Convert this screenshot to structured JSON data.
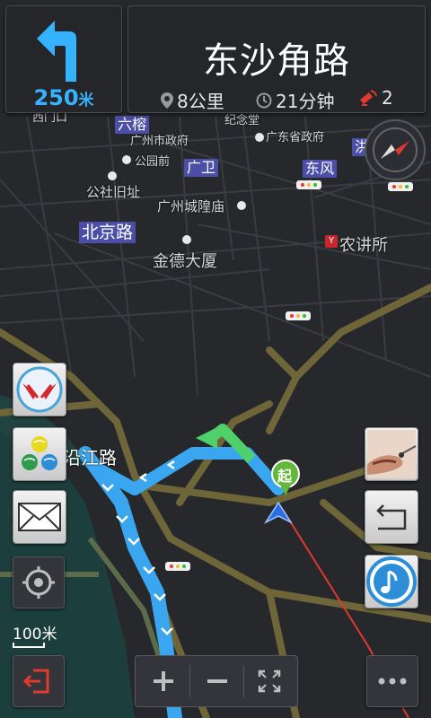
{
  "turn": {
    "distance_value": "250",
    "distance_unit": "米",
    "icon": "turn-left-arrow-icon"
  },
  "road": {
    "name": "东沙角路"
  },
  "stats": {
    "remaining_distance": "8公里",
    "remaining_time": "21分钟",
    "camera_count": "2"
  },
  "map_labels": {
    "xidi": "西门口",
    "liurong": "六榕",
    "gov": "广州市政府",
    "jinian": "纪念堂",
    "prov_gov": "广东省政府",
    "gongyuan": "公园前",
    "guangwei": "广卫",
    "dongfeng": "东风",
    "hongqiao": "洪",
    "gongshe": "公社旧址",
    "chenghuang": "广州城隍庙",
    "beijing": "北京路",
    "nongjiang": "农讲所",
    "jinde": "金德大厦",
    "yanjiang": "沿江路",
    "start": "起"
  },
  "scale": {
    "label": "100米"
  },
  "colors": {
    "route": "#3aa6ef",
    "next_turn": "#4fd06a",
    "accent": "#35b3ff",
    "road": "#756d3c",
    "camera": "#e03a2f"
  },
  "icons": [
    "compass-icon",
    "wings-logo-icon",
    "dots-app-icon",
    "mail-icon",
    "locate-icon",
    "exit-icon",
    "mouth-voice-icon",
    "back-route-icon",
    "music-icon",
    "zoom-in-icon",
    "zoom-out-icon",
    "fullscreen-icon",
    "more-icon"
  ]
}
